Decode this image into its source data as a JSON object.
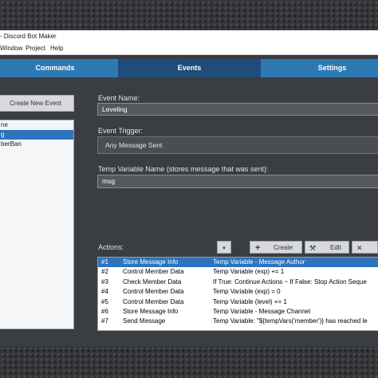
{
  "window": {
    "title": "- Discord Bot Maker",
    "menu": [
      "Window",
      "Project",
      "Help"
    ]
  },
  "tabs": [
    {
      "label": "Commands",
      "active": false
    },
    {
      "label": "Events",
      "active": true
    },
    {
      "label": "Settings",
      "active": false
    }
  ],
  "sidebar": {
    "create_button": "Create New Event",
    "events": [
      {
        "label": "ne",
        "selected": false
      },
      {
        "label": "g",
        "selected": true
      },
      {
        "label": "berBan",
        "selected": false
      }
    ]
  },
  "form": {
    "event_name_label": "Event Name:",
    "event_name_value": "Leveling",
    "event_trigger_label": "Event Trigger:",
    "event_trigger_value": "Any Message Sent",
    "temp_var_label": "Temp Variable Name (stores message that was sent):",
    "temp_var_value": "msg"
  },
  "actions": {
    "label": "Actions:",
    "toolbar": {
      "up": "▲",
      "down": "▼",
      "create": "Create",
      "edit": "Edit"
    },
    "rows": [
      {
        "num": "#1",
        "name": "Store Message Info",
        "desc": "Temp Variable - Message Author",
        "selected": true
      },
      {
        "num": "#2",
        "name": "Control Member Data",
        "desc": "Temp Variable (exp) += 1",
        "selected": false
      },
      {
        "num": "#3",
        "name": "Check Member Data",
        "desc": "If True: Continue Actions ~ If False: Stop Action Seque",
        "selected": false
      },
      {
        "num": "#4",
        "name": "Control Member Data",
        "desc": "Temp Variable (exp) = 0",
        "selected": false
      },
      {
        "num": "#5",
        "name": "Control Member Data",
        "desc": "Temp Variable (level) += 1",
        "selected": false
      },
      {
        "num": "#6",
        "name": "Store Message Info",
        "desc": "Temp Variable - Message Channel",
        "selected": false
      },
      {
        "num": "#7",
        "name": "Send Message",
        "desc": "Temp Variable: \"${tempVars('member')} has reached le",
        "selected": false
      }
    ]
  },
  "colors": {
    "tab_bar": "#2f79b3",
    "tab_active": "#1f4c78",
    "panel_bg": "#3a3d41",
    "selection": "#2e73bd"
  }
}
